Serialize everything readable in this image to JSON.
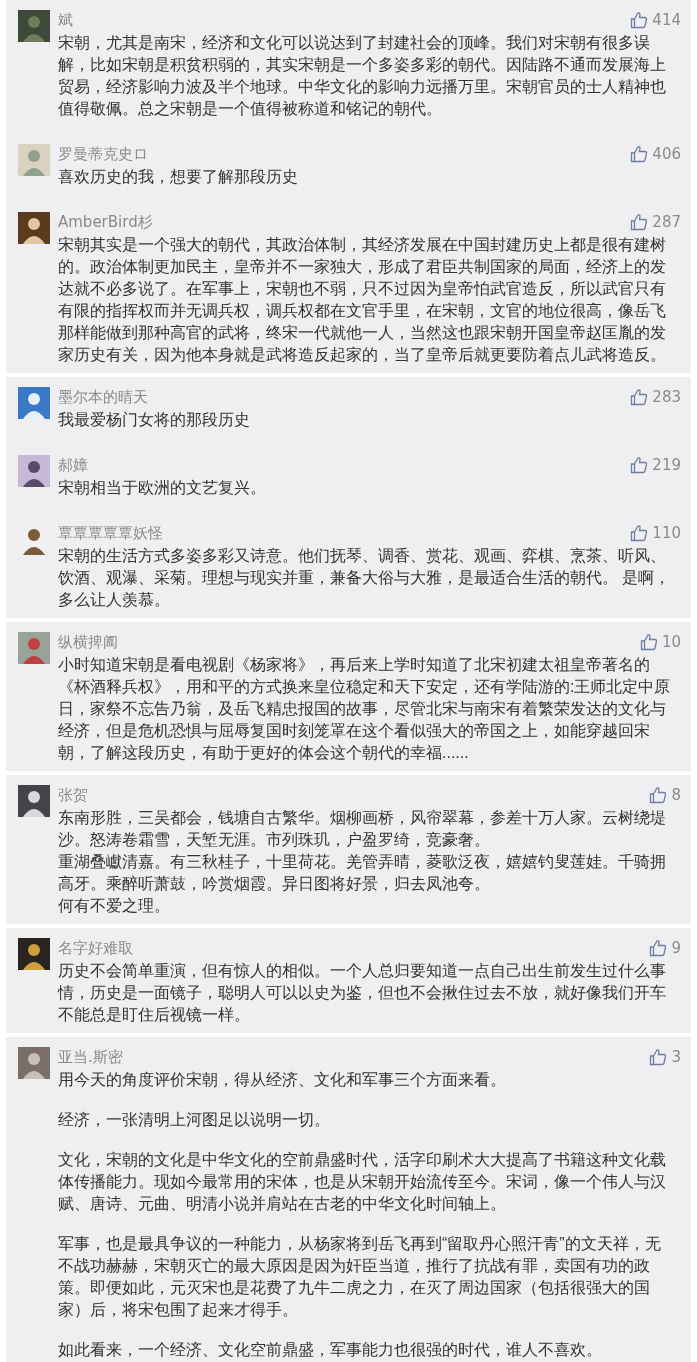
{
  "cards": [
    {
      "comments": [
        {
          "name": "斌",
          "likes": "414",
          "paragraphs": [
            "宋朝，尤其是南宋，经济和文化可以说达到了封建社会的顶峰。我们对宋朝有很多误解，比如宋朝是积贫积弱的，其实宋朝是一个多姿多彩的朝代。因陆路不通而发展海上贸易，经济影响力波及半个地球。中华文化的影响力远播万里。宋朝官员的士人精神也值得敬佩。总之宋朝是一个值得被称道和铭记的朝代。"
          ]
        },
        {
          "name": "罗曼蒂克史ロ",
          "likes": "406",
          "paragraphs": [
            "喜欢历史的我，想要了解那段历史"
          ]
        },
        {
          "name": "AmberBird杉",
          "likes": "287",
          "paragraphs": [
            "宋朝其实是一个强大的朝代，其政治体制，其经济发展在中国封建历史上都是很有建树的。政治体制更加民主，皇帝并不一家独大，形成了君臣共制国家的局面，经济上的发达就不必多说了。在军事上，宋朝也不弱，只不过因为皇帝怕武官造反，所以武官只有有限的指挥权而并无调兵权，调兵权都在文官手里，在宋朝，文官的地位很高，像岳飞那样能做到那种高官的武将，终宋一代就他一人，当然这也跟宋朝开国皇帝赵匡胤的发家历史有关，因为他本身就是武将造反起家的，当了皇帝后就更要防着点儿武将造反。"
          ]
        }
      ]
    },
    {
      "comments": [
        {
          "name": "墨尔本的晴天",
          "likes": "283",
          "paragraphs": [
            "我最爱杨门女将的那段历史"
          ]
        },
        {
          "name": "郝嫜",
          "likes": "219",
          "paragraphs": [
            "宋朝相当于欧洲的文艺复兴。"
          ]
        },
        {
          "name": "覃覃覃覃覃妖怪",
          "likes": "110",
          "paragraphs": [
            "宋朝的生活方式多姿多彩又诗意。他们抚琴、调香、赏花、观画、弈棋、烹茶、听风、饮酒、观瀑、采菊。理想与现实并重，兼备大俗与大雅，是最适合生活的朝代。 是啊，多么让人羡慕。"
          ]
        }
      ]
    },
    {
      "comments": [
        {
          "name": "纵横捭阖",
          "likes": "10",
          "paragraphs": [
            "小时知道宋朝是看电视剧《杨家将》，再后来上学时知道了北宋初建太祖皇帝著名的《杯酒释兵权》，用和平的方式换来皇位稳定和天下安定，还有学陆游的:王师北定中原日，家祭不忘告乃翁，及岳飞精忠报国的故事，尽管北宋与南宋有着繁荣发达的文化与经济，但是危机恐惧与屈辱复国时刻笼罩在这个看似强大的帝国之上，如能穿越回宋朝，了解这段历史，有助于更好的体会这个朝代的幸福......"
          ]
        }
      ]
    },
    {
      "comments": [
        {
          "name": "张贺",
          "likes": "8",
          "lines": [
            "东南形胜，三吴都会，钱塘自古繁华。烟柳画桥，风帘翠幕，参差十万人家。云树绕堤沙。怒涛卷霜雪，天堑无涯。市列珠玑，户盈罗绮，竞豪奢。",
            "重湖叠巘清嘉。有三秋桂子，十里荷花。羌管弄晴，菱歌泛夜，嬉嬉钓叟莲娃。千骑拥高牙。乘醉听萧鼓，吟赏烟霞。异日图将好景，归去凤池夸。",
            "何有不爱之理。"
          ]
        }
      ]
    },
    {
      "comments": [
        {
          "name": "名字好难取",
          "likes": "9",
          "paragraphs": [
            "历史不会简单重演，但有惊人的相似。一个人总归要知道一点自己出生前发生过什么事情，历史是一面镜子，聪明人可以以史为鉴，但也不会揪住过去不放，就好像我们开车不能总是盯住后视镜一样。"
          ]
        }
      ]
    },
    {
      "comments": [
        {
          "name": "亚当.斯密",
          "likes": "3",
          "paragraphs": [
            "用今天的角度评价宋朝，得从经济、文化和军事三个方面来看。",
            "经济，一张清明上河图足以说明一切。",
            "文化，宋朝的文化是中华文化的空前鼎盛时代，活字印刷术大大提高了书籍这种文化载体传播能力。现如今最常用的宋体，也是从宋朝开始流传至今。宋词，像一个伟人与汉赋、唐诗、元曲、明清小说并肩站在古老的中华文化时间轴上。",
            "军事，也是最具争议的一种能力，从杨家将到岳飞再到“留取丹心照汗青”的文天祥，无不战功赫赫，宋朝灭亡的最大原因是因为奸臣当道，推行了抗战有罪，卖国有功的政策。即便如此，元灭宋也是花费了九牛二虎之力，在灭了周边国家（包括很强大的国家）后，将宋包围了起来才得手。",
            "如此看来，一个经济、文化空前鼎盛，军事能力也很强的时代，谁人不喜欢。"
          ]
        }
      ]
    }
  ]
}
